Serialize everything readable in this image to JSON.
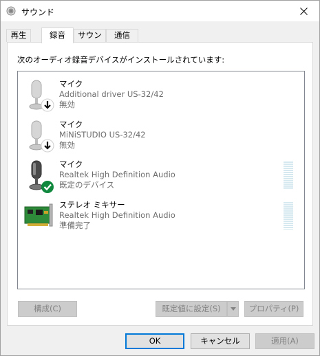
{
  "window": {
    "title": "サウンド"
  },
  "tabs": [
    {
      "label": "再生",
      "active": false
    },
    {
      "label": "録音",
      "active": true
    },
    {
      "label": "サウンド",
      "active": false
    },
    {
      "label": "通信",
      "active": false
    }
  ],
  "panel": {
    "instruction": "次のオーディオ録音デバイスがインストールされています:"
  },
  "devices": [
    {
      "name": "マイク",
      "driver": "Additional driver US-32/42",
      "status": "無効",
      "icon": "microphone-disabled-icon"
    },
    {
      "name": "マイク",
      "driver": "MiNiSTUDIO US-32/42",
      "status": "無効",
      "icon": "microphone-disabled-icon"
    },
    {
      "name": "マイク",
      "driver": "Realtek High Definition Audio",
      "status": "既定のデバイス",
      "icon": "microphone-default-icon"
    },
    {
      "name": "ステレオ ミキサー",
      "driver": "Realtek High Definition Audio",
      "status": "準備完了",
      "icon": "sound-card-icon"
    }
  ],
  "buttons": {
    "configure": "構成(C)",
    "set_default": "既定値に設定(S)",
    "properties": "プロパティ(P)",
    "ok": "OK",
    "cancel": "キャンセル",
    "apply": "適用(A)"
  },
  "colors": {
    "accent": "#0078d7",
    "default_check": "#10893e"
  }
}
